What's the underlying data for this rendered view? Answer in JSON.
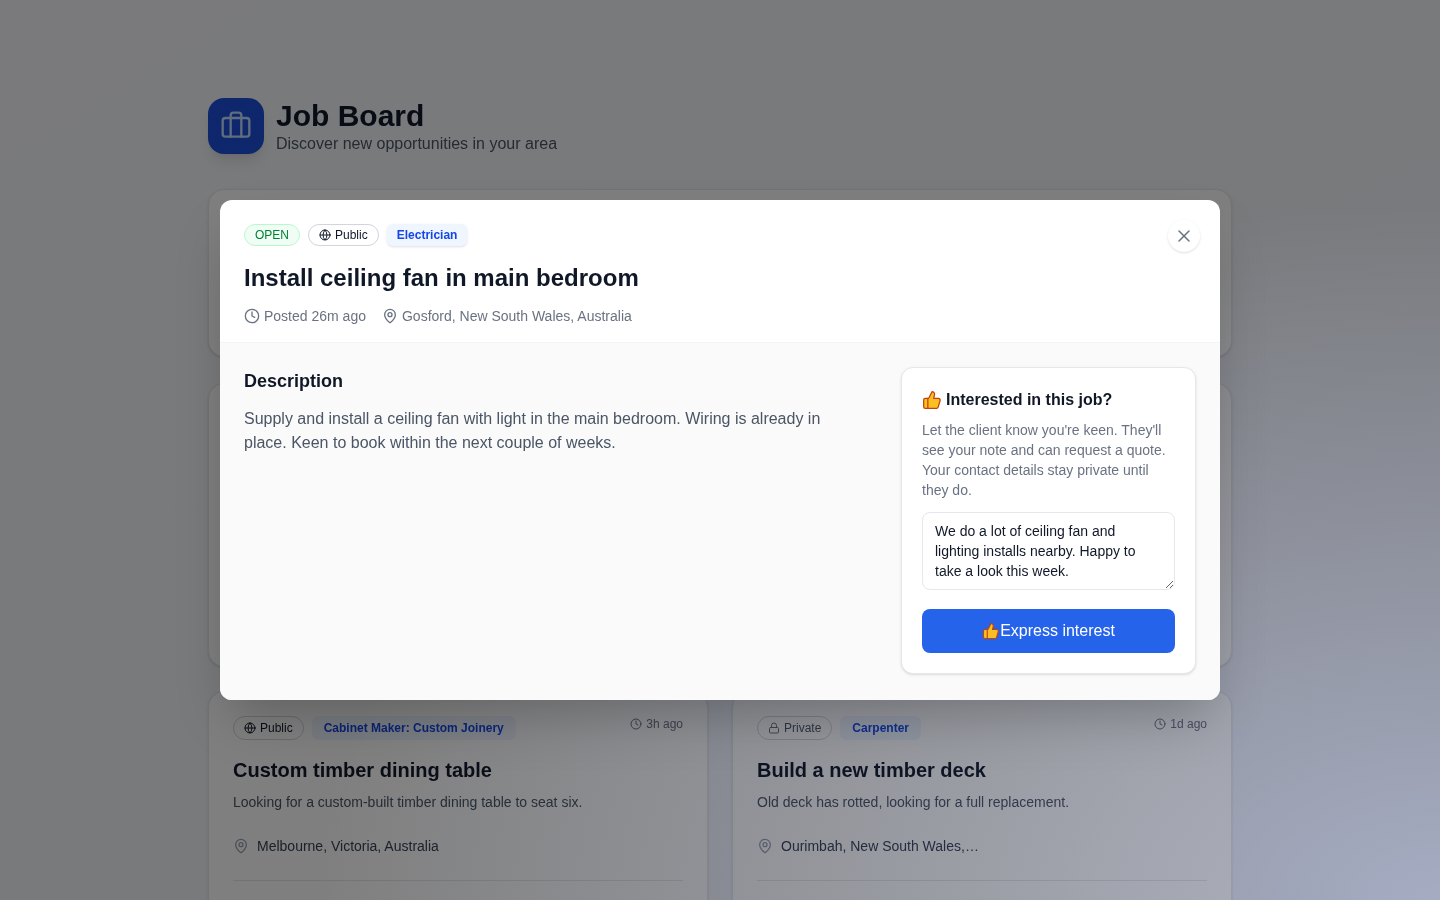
{
  "header": {
    "title": "Job Board",
    "subtitle": "Discover new opportunities in your area"
  },
  "modal": {
    "status": "OPEN",
    "visibility": {
      "kind": "public",
      "label": "Public"
    },
    "category": "Electrician",
    "title": "Install ceiling fan in main bedroom",
    "posted": "Posted 26m ago",
    "location": "Gosford, New South Wales, Australia",
    "description_heading": "Description",
    "description": "Supply and install a ceiling fan with light in the main bedroom. Wiring is already in place. Keen to book within the next couple of weeks.",
    "interest_panel": {
      "heading": "Interested in this job?",
      "text": "Let the client know you're keen. They'll see your note and can request a quote. Your contact details stay private until they do.",
      "message": {
        "value": "We do a lot of ceiling fan and lighting installs nearby. Happy to take a look this week."
      },
      "button": "Express interest"
    }
  },
  "job_cards": [
    {
      "visibility": {
        "kind": "public",
        "label": "Public"
      },
      "category": "Cabinet Maker: Custom Joinery",
      "posted": "3h ago",
      "title": "Custom timber dining table",
      "summary": "Looking for a custom-built timber dining table to seat six.",
      "location": "Melbourne, Victoria, Australia"
    },
    {
      "visibility": {
        "kind": "private",
        "label": "Private"
      },
      "category": "Carpenter",
      "posted": "1d ago",
      "title": "Build a new timber deck",
      "summary": "Old deck has rotted, looking for a full replacement.",
      "location": "Ourimbah, New South Wales,…"
    }
  ]
}
